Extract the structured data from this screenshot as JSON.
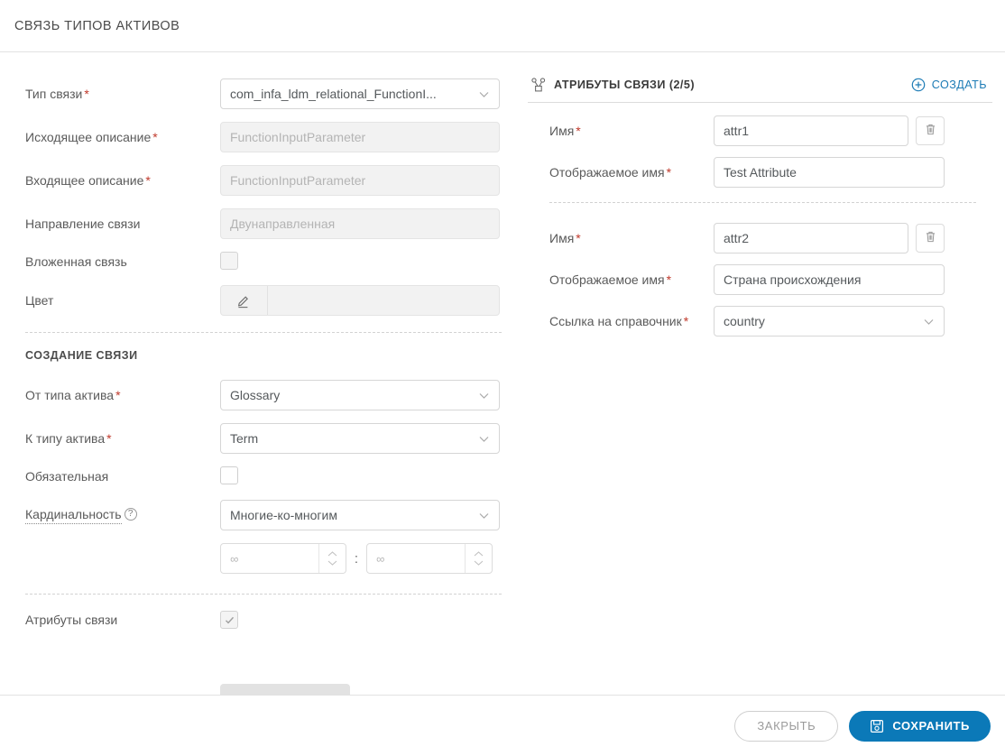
{
  "header": {
    "title": "СВЯЗЬ ТИПОВ АКТИВОВ"
  },
  "colors": {
    "accent": "#0b79b8",
    "link": "#1c7bb5",
    "required": "#c0392b",
    "border": "#d6d6d6",
    "disabled_bg": "#f2f2f2"
  },
  "left_form": {
    "fields": [
      {
        "label": "Тип связи",
        "required": true,
        "value": "com_infa_ldm_relational_FunctionI...",
        "control": "select",
        "disabled": false
      },
      {
        "label": "Исходящее описание",
        "required": true,
        "value": "FunctionInputParameter",
        "control": "text",
        "disabled": true
      },
      {
        "label": "Входящее описание",
        "required": true,
        "value": "FunctionInputParameter",
        "control": "text",
        "disabled": true
      },
      {
        "label": "Направление связи",
        "required": false,
        "value": "Двунаправленная",
        "control": "text",
        "disabled": true
      },
      {
        "label": "Вложенная связь",
        "required": false,
        "value": "",
        "control": "checkbox",
        "checked": false,
        "disabled": true
      },
      {
        "label": "Цвет",
        "required": false,
        "value": "",
        "control": "color",
        "disabled": true
      }
    ],
    "section": {
      "title": "СОЗДАНИЕ СВЯЗИ",
      "fields": [
        {
          "label": "От типа актива",
          "required": true,
          "value": "Glossary",
          "control": "select",
          "disabled": false
        },
        {
          "label": "К типу актива",
          "required": true,
          "value": "Term",
          "control": "select",
          "disabled": false
        },
        {
          "label": "Обязательная",
          "required": false,
          "value": "",
          "control": "checkbox",
          "checked": false,
          "disabled": false
        },
        {
          "label": "Кардинальность",
          "required": false,
          "value": "Многие-ко-многим",
          "control": "select-hint",
          "disabled": false,
          "help_icon": "question-mark-icon"
        }
      ],
      "cardinality": {
        "left_value": "∞",
        "separator": ":",
        "right_value": "∞"
      }
    },
    "attributes_toggle": {
      "label": "Атрибуты связи",
      "checked": true,
      "disabled": true
    }
  },
  "right_panel": {
    "icon": "relationship-attributes-icon",
    "title": "АТРИБУТЫ СВЯЗИ (2/5)",
    "create_label": "СОЗДАТЬ",
    "create_icon": "plus-circle-icon",
    "attributes": [
      {
        "name_label": "Имя",
        "name_value": "attr1",
        "display_label": "Отображаемое имя",
        "display_value": "Test Attribute",
        "delete_icon": "trash-icon",
        "reference_label": null,
        "reference_value": null
      },
      {
        "name_label": "Имя",
        "name_value": "attr2",
        "display_label": "Отображаемое имя",
        "display_value": "Страна происхождения",
        "delete_icon": "trash-icon",
        "reference_label": "Ссылка на справочник",
        "reference_value": "country"
      }
    ]
  },
  "footer": {
    "close_label": "ЗАКРЫТЬ",
    "save_label": "СОХРАНИТЬ",
    "save_icon": "save-floppy-icon"
  }
}
